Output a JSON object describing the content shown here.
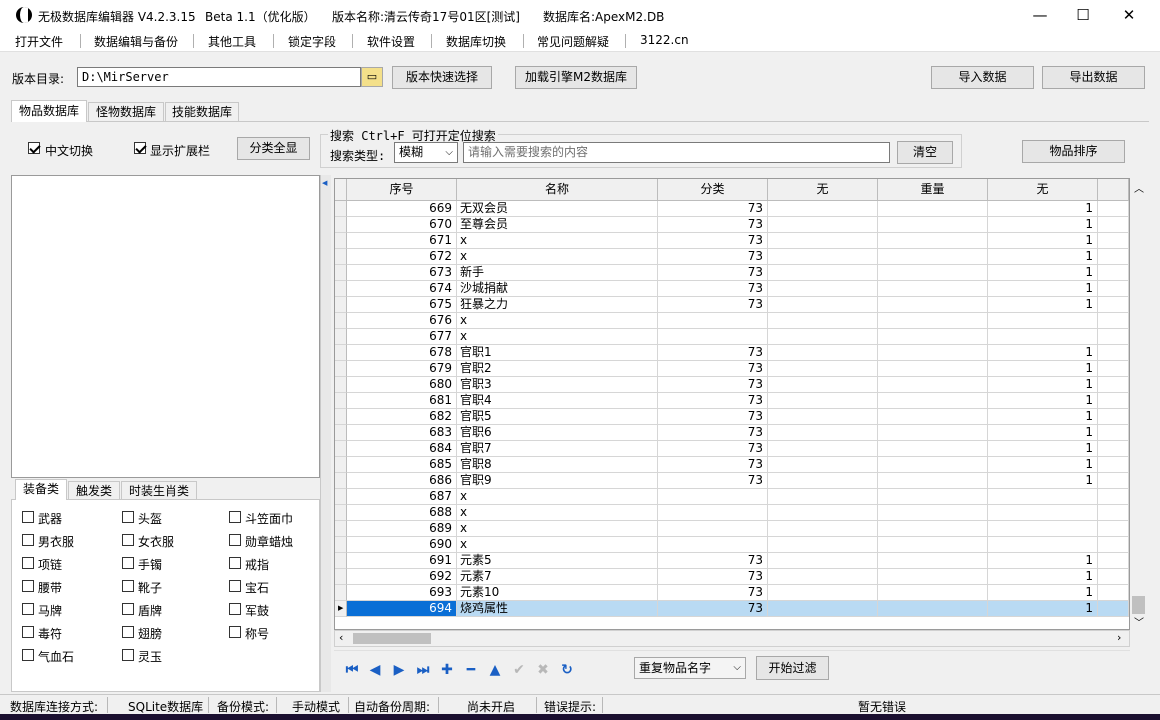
{
  "window": {
    "app_title": "无极数据库编辑器 V4.2.3.15",
    "beta": "Beta 1.1（优化版）",
    "version_name": "版本名称:清云传奇17号01区[测试]",
    "db_name": "数据库名:ApexM2.DB",
    "minimize": "—",
    "maximize": "☐",
    "close": "✕"
  },
  "menu": [
    "打开文件",
    "数据编辑与备份",
    "其他工具",
    "锁定字段",
    "软件设置",
    "数据库切换",
    "常见问题解疑",
    "3122.cn"
  ],
  "toolbar": {
    "dir_label": "版本目录:",
    "dir_value": "D:\\MirServer",
    "quick_select": "版本快速选择",
    "load_engine": "加载引擎M2数据库",
    "import": "导入数据",
    "export": "导出数据"
  },
  "db_tabs": [
    "物品数据库",
    "怪物数据库",
    "技能数据库"
  ],
  "options": {
    "chinese_switch": "中文切换",
    "show_ext": "显示扩展栏",
    "show_all": "分类全显",
    "search_group": "搜索  Ctrl+F 可打开定位搜索",
    "search_type_label": "搜索类型:",
    "search_type_value": "模糊",
    "search_placeholder": "请输入需要搜索的内容",
    "clear": "清空",
    "sort": "物品排序"
  },
  "category_tabs": [
    "装备类",
    "触发类",
    "时装生肖类"
  ],
  "categories": [
    [
      "武器",
      "头盔",
      "斗笠面巾"
    ],
    [
      "男衣服",
      "女衣服",
      "勋章蜡烛"
    ],
    [
      "项链",
      "手镯",
      "戒指"
    ],
    [
      "腰带",
      "靴子",
      "宝石"
    ],
    [
      "马牌",
      "盾牌",
      "军鼓"
    ],
    [
      "毒符",
      "翅膀",
      "称号"
    ],
    [
      "气血石",
      "灵玉"
    ]
  ],
  "table": {
    "headers": [
      "序号",
      "名称",
      "分类",
      "无",
      "重量",
      "无"
    ],
    "rows": [
      [
        "669",
        "无双会员",
        "73",
        "",
        "",
        "1"
      ],
      [
        "670",
        "至尊会员",
        "73",
        "",
        "",
        "1"
      ],
      [
        "671",
        "x",
        "73",
        "",
        "",
        "1"
      ],
      [
        "672",
        "x",
        "73",
        "",
        "",
        "1"
      ],
      [
        "673",
        "新手",
        "73",
        "",
        "",
        "1"
      ],
      [
        "674",
        "沙城捐献",
        "73",
        "",
        "",
        "1"
      ],
      [
        "675",
        "狂暴之力",
        "73",
        "",
        "",
        "1"
      ],
      [
        "676",
        "x",
        "",
        "",
        "",
        ""
      ],
      [
        "677",
        "x",
        "",
        "",
        "",
        ""
      ],
      [
        "678",
        "官职1",
        "73",
        "",
        "",
        "1"
      ],
      [
        "679",
        "官职2",
        "73",
        "",
        "",
        "1"
      ],
      [
        "680",
        "官职3",
        "73",
        "",
        "",
        "1"
      ],
      [
        "681",
        "官职4",
        "73",
        "",
        "",
        "1"
      ],
      [
        "682",
        "官职5",
        "73",
        "",
        "",
        "1"
      ],
      [
        "683",
        "官职6",
        "73",
        "",
        "",
        "1"
      ],
      [
        "684",
        "官职7",
        "73",
        "",
        "",
        "1"
      ],
      [
        "685",
        "官职8",
        "73",
        "",
        "",
        "1"
      ],
      [
        "686",
        "官职9",
        "73",
        "",
        "",
        "1"
      ],
      [
        "687",
        "x",
        "",
        "",
        "",
        ""
      ],
      [
        "688",
        "x",
        "",
        "",
        "",
        ""
      ],
      [
        "689",
        "x",
        "",
        "",
        "",
        ""
      ],
      [
        "690",
        "x",
        "",
        "",
        "",
        ""
      ],
      [
        "691",
        "元素5",
        "73",
        "",
        "",
        "1"
      ],
      [
        "692",
        "元素7",
        "73",
        "",
        "",
        "1"
      ],
      [
        "693",
        "元素10",
        "73",
        "",
        "",
        "1"
      ],
      [
        "694",
        "烧鸡属性",
        "73",
        "",
        "",
        "1"
      ]
    ],
    "selected_row": "694"
  },
  "bottom": {
    "filter_value": "重复物品名字",
    "start_filter": "开始过滤"
  },
  "status": {
    "conn_label": "数据库连接方式:",
    "conn_value": "SQLite数据库",
    "backup_label": "备份模式:",
    "backup_value": "手动模式",
    "auto_label": "自动备份周期:",
    "auto_value": "尚未开启",
    "err_label": "错误提示:",
    "err_value": "暂无错误"
  }
}
